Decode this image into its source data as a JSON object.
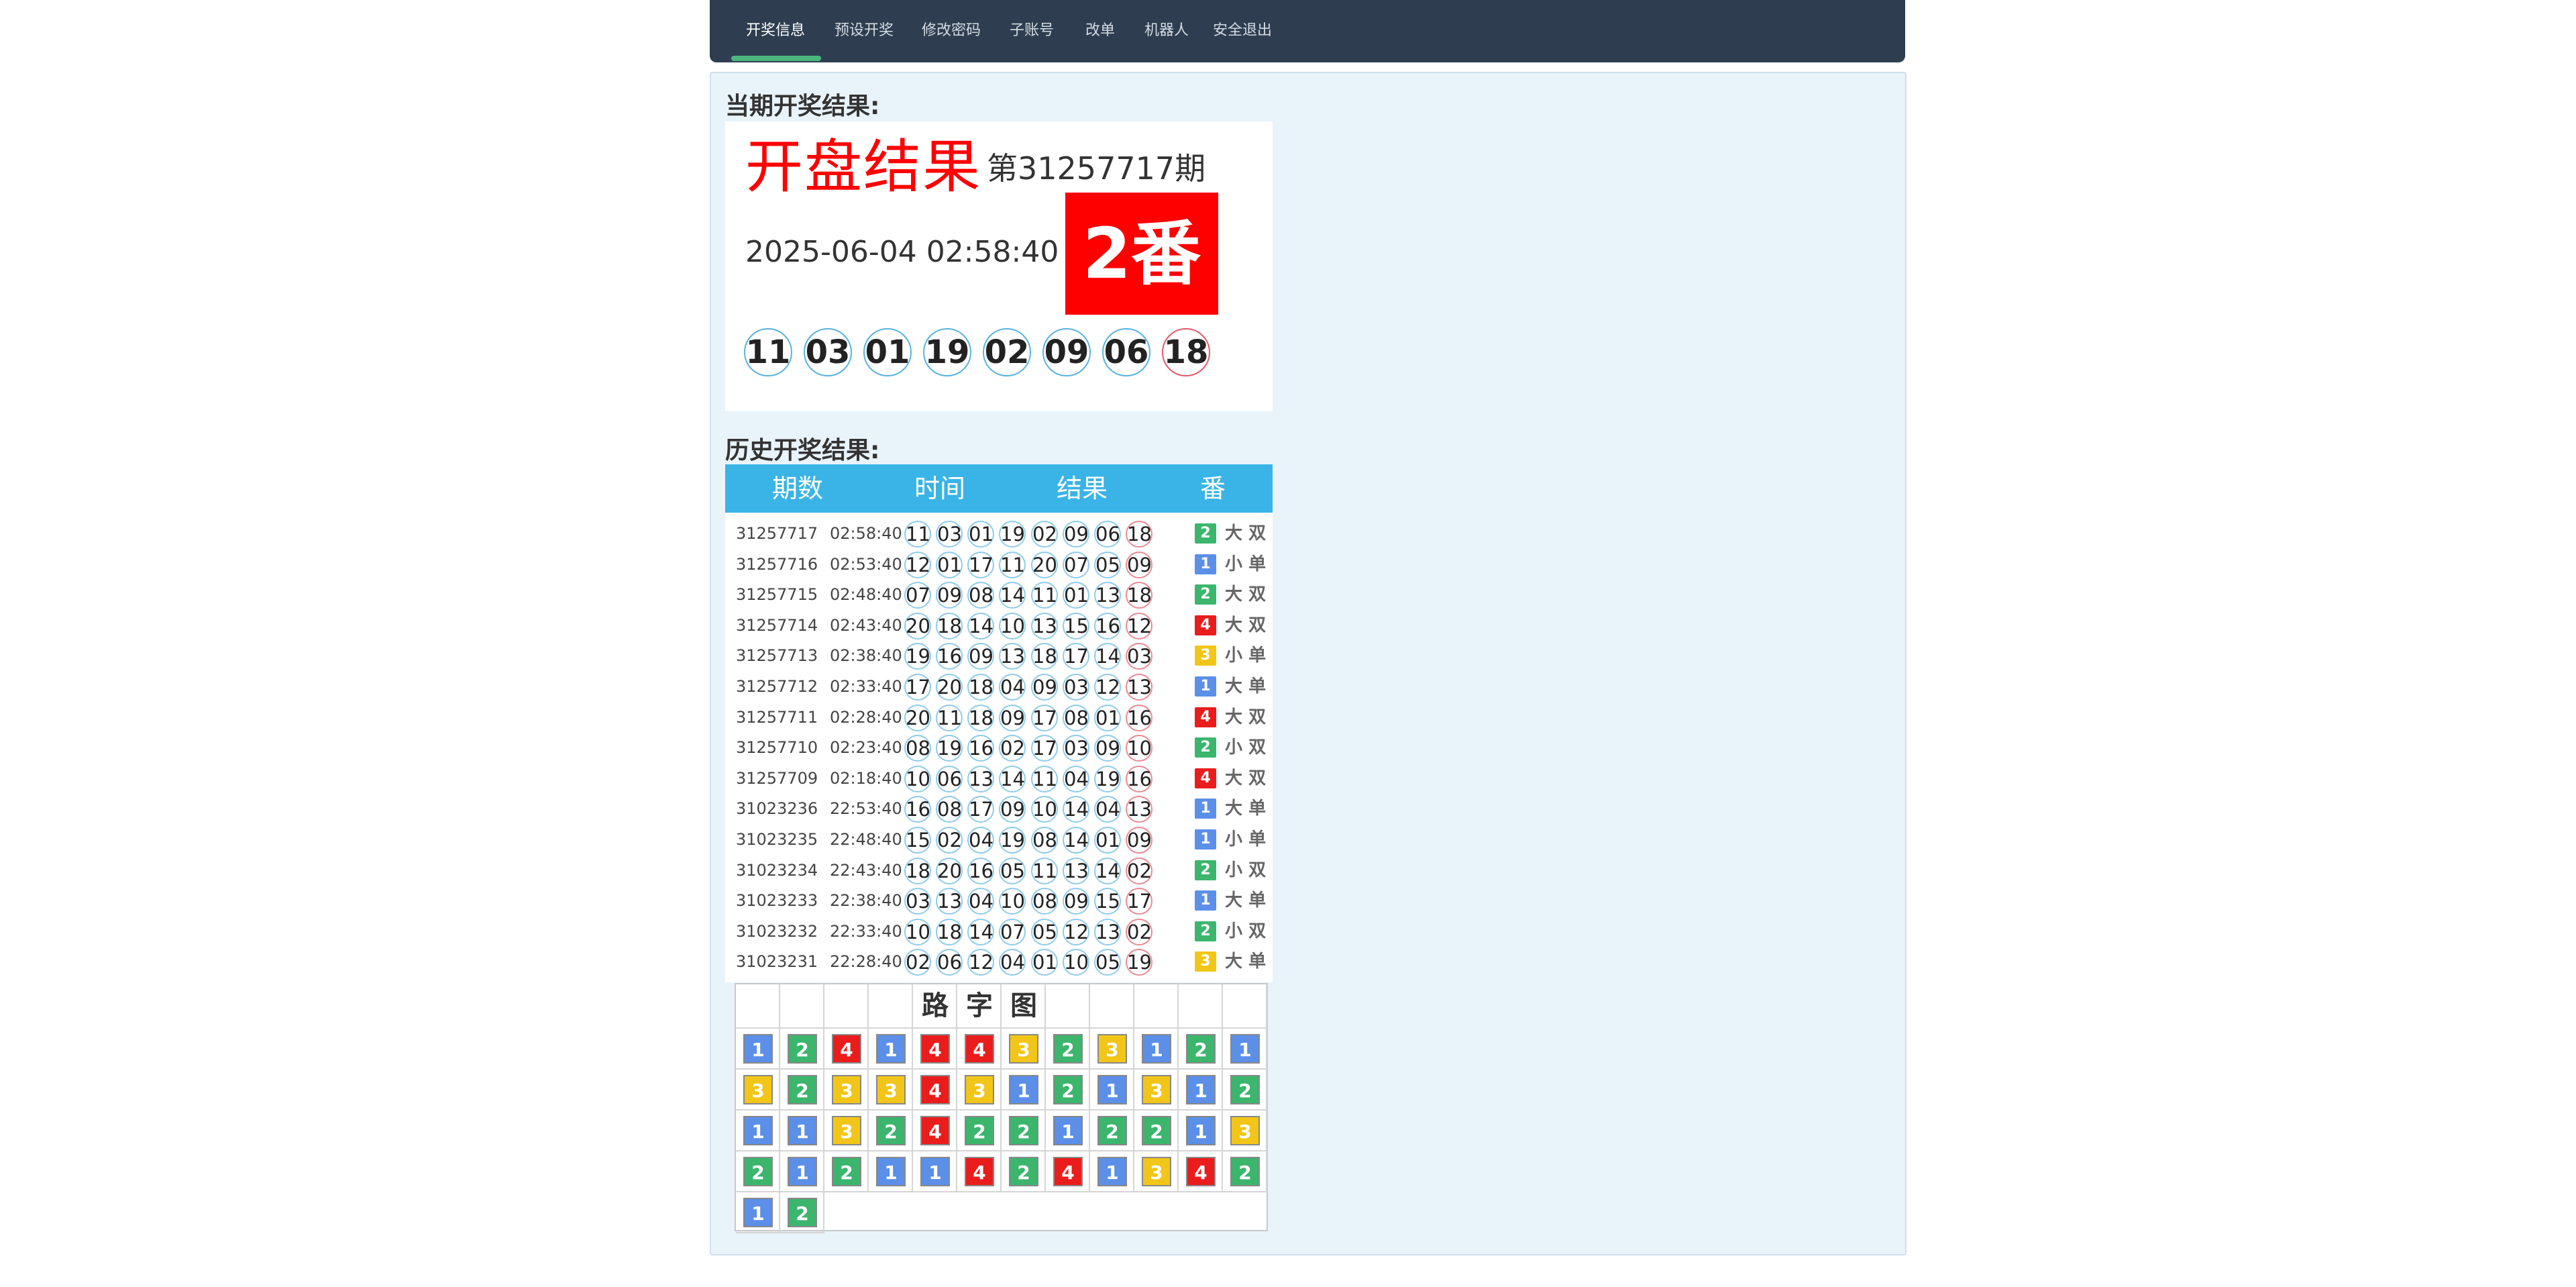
{
  "nav": {
    "items": [
      "开奖信息",
      "预设开奖",
      "修改密码",
      "子账号",
      "改单",
      "机器人",
      "安全退出"
    ],
    "active": 0
  },
  "current": {
    "section_title": "当期开奖结果:",
    "title": "开盘结果",
    "issue_text": "第31257717期",
    "datetime": "2025-06-04 02:58:40",
    "fan": "2番",
    "balls": [
      "11",
      "03",
      "01",
      "19",
      "02",
      "09",
      "06",
      "18"
    ]
  },
  "history": {
    "section_title": "历史开奖结果:",
    "headers": [
      "期数",
      "时间",
      "结果",
      "番"
    ],
    "rows": [
      {
        "issue": "31257717",
        "time": "02:58:40",
        "balls": [
          "11",
          "03",
          "01",
          "19",
          "02",
          "09",
          "06",
          "18"
        ],
        "fan": "2",
        "size": "大",
        "parity": "双"
      },
      {
        "issue": "31257716",
        "time": "02:53:40",
        "balls": [
          "12",
          "01",
          "17",
          "11",
          "20",
          "07",
          "05",
          "09"
        ],
        "fan": "1",
        "size": "小",
        "parity": "单"
      },
      {
        "issue": "31257715",
        "time": "02:48:40",
        "balls": [
          "07",
          "09",
          "08",
          "14",
          "11",
          "01",
          "13",
          "18"
        ],
        "fan": "2",
        "size": "大",
        "parity": "双"
      },
      {
        "issue": "31257714",
        "time": "02:43:40",
        "balls": [
          "20",
          "18",
          "14",
          "10",
          "13",
          "15",
          "16",
          "12"
        ],
        "fan": "4",
        "size": "大",
        "parity": "双"
      },
      {
        "issue": "31257713",
        "time": "02:38:40",
        "balls": [
          "19",
          "16",
          "09",
          "13",
          "18",
          "17",
          "14",
          "03"
        ],
        "fan": "3",
        "size": "小",
        "parity": "单"
      },
      {
        "issue": "31257712",
        "time": "02:33:40",
        "balls": [
          "17",
          "20",
          "18",
          "04",
          "09",
          "03",
          "12",
          "13"
        ],
        "fan": "1",
        "size": "大",
        "parity": "单"
      },
      {
        "issue": "31257711",
        "time": "02:28:40",
        "balls": [
          "20",
          "11",
          "18",
          "09",
          "17",
          "08",
          "01",
          "16"
        ],
        "fan": "4",
        "size": "大",
        "parity": "双"
      },
      {
        "issue": "31257710",
        "time": "02:23:40",
        "balls": [
          "08",
          "19",
          "16",
          "02",
          "17",
          "03",
          "09",
          "10"
        ],
        "fan": "2",
        "size": "小",
        "parity": "双"
      },
      {
        "issue": "31257709",
        "time": "02:18:40",
        "balls": [
          "10",
          "06",
          "13",
          "14",
          "11",
          "04",
          "19",
          "16"
        ],
        "fan": "4",
        "size": "大",
        "parity": "双"
      },
      {
        "issue": "31023236",
        "time": "22:53:40",
        "balls": [
          "16",
          "08",
          "17",
          "09",
          "10",
          "14",
          "04",
          "13"
        ],
        "fan": "1",
        "size": "大",
        "parity": "单"
      },
      {
        "issue": "31023235",
        "time": "22:48:40",
        "balls": [
          "15",
          "02",
          "04",
          "19",
          "08",
          "14",
          "01",
          "09"
        ],
        "fan": "1",
        "size": "小",
        "parity": "单"
      },
      {
        "issue": "31023234",
        "time": "22:43:40",
        "balls": [
          "18",
          "20",
          "16",
          "05",
          "11",
          "13",
          "14",
          "02"
        ],
        "fan": "2",
        "size": "小",
        "parity": "双"
      },
      {
        "issue": "31023233",
        "time": "22:38:40",
        "balls": [
          "03",
          "13",
          "04",
          "10",
          "08",
          "09",
          "15",
          "17"
        ],
        "fan": "1",
        "size": "大",
        "parity": "单"
      },
      {
        "issue": "31023232",
        "time": "22:33:40",
        "balls": [
          "10",
          "18",
          "14",
          "07",
          "05",
          "12",
          "13",
          "02"
        ],
        "fan": "2",
        "size": "小",
        "parity": "双"
      },
      {
        "issue": "31023231",
        "time": "22:28:40",
        "balls": [
          "02",
          "06",
          "12",
          "04",
          "01",
          "10",
          "05",
          "19"
        ],
        "fan": "3",
        "size": "大",
        "parity": "单"
      }
    ]
  },
  "road": {
    "title": [
      "路",
      "字",
      "图"
    ],
    "rows": [
      [
        "1",
        "2",
        "4",
        "1",
        "4",
        "4",
        "3",
        "2",
        "3",
        "1",
        "2",
        "1"
      ],
      [
        "3",
        "2",
        "3",
        "3",
        "4",
        "3",
        "1",
        "2",
        "1",
        "3",
        "1",
        "2"
      ],
      [
        "1",
        "1",
        "3",
        "2",
        "4",
        "2",
        "2",
        "1",
        "2",
        "2",
        "1",
        "3"
      ],
      [
        "2",
        "1",
        "2",
        "1",
        "1",
        "4",
        "2",
        "4",
        "1",
        "3",
        "4",
        "2"
      ],
      [
        "1",
        "2"
      ]
    ]
  },
  "colors": {
    "fan_1": "#5b8fe8",
    "fan_2": "#3cb56d",
    "fan_3": "#f2c618",
    "fan_4": "#ea1c1c",
    "navbar": "#2e3e50",
    "table_header": "#3ab4e6",
    "result_red": "#ff0000"
  }
}
